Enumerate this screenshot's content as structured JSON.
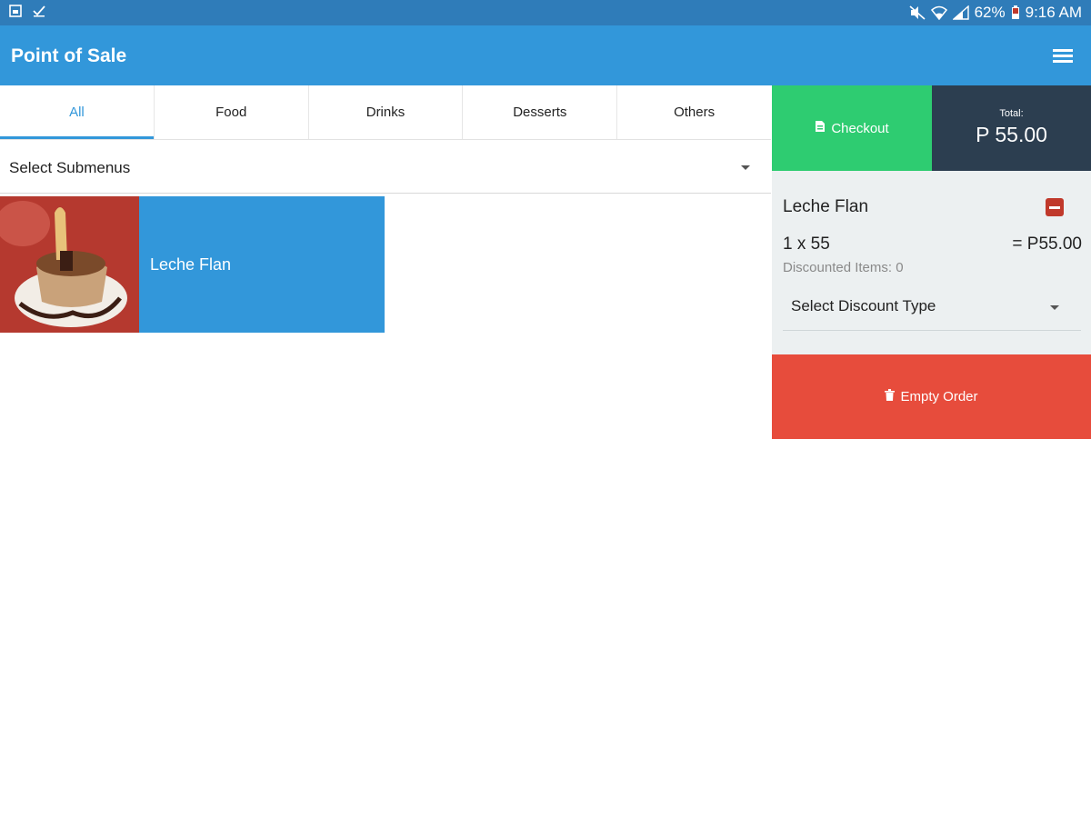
{
  "status_bar": {
    "battery": "62%",
    "time": "9:16 AM"
  },
  "app_bar": {
    "title": "Point of Sale"
  },
  "tabs": [
    {
      "label": "All",
      "active": true
    },
    {
      "label": "Food",
      "active": false
    },
    {
      "label": "Drinks",
      "active": false
    },
    {
      "label": "Desserts",
      "active": false
    },
    {
      "label": "Others",
      "active": false
    }
  ],
  "submenu": {
    "label": "Select Submenus"
  },
  "products": [
    {
      "name": "Leche Flan"
    }
  ],
  "checkout": {
    "label": "Checkout"
  },
  "total": {
    "label": "Total:",
    "value": "P 55.00"
  },
  "order": {
    "items": [
      {
        "name": "Leche Flan",
        "qty_line": "1 x 55",
        "line_total": "= P55.00",
        "discounted": "Discounted Items: 0"
      }
    ],
    "discount_placeholder": "Select Discount Type"
  },
  "empty_order": {
    "label": "Empty Order"
  },
  "colors": {
    "primary": "#3297da",
    "status_bar": "#2f7cb9",
    "checkout": "#2ecc71",
    "total_bg": "#2c3e50",
    "empty": "#e74c3c",
    "panel_bg": "#ecf0f1"
  }
}
